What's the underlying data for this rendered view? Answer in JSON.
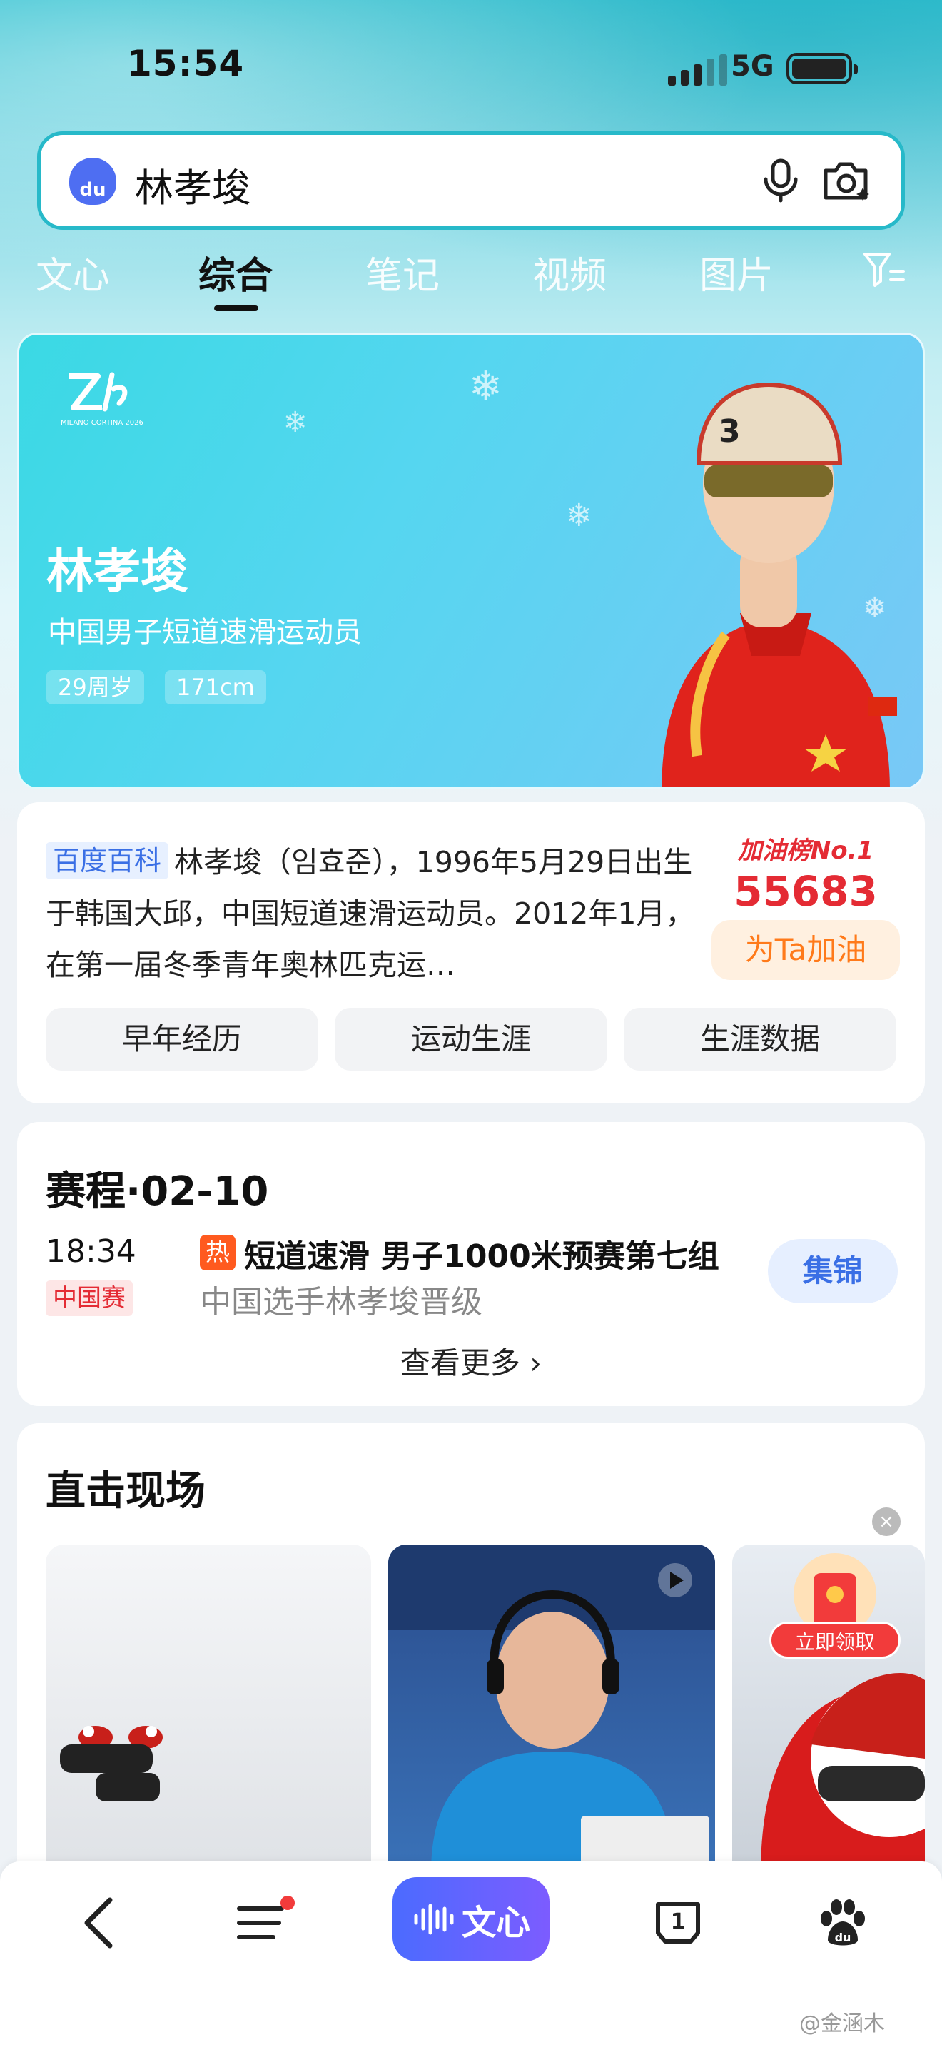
{
  "status_bar": {
    "time": "15:54",
    "network": "5G"
  },
  "search": {
    "query": "林孝埈",
    "logo_text": "du"
  },
  "tabs": [
    "文心",
    "综合",
    "笔记",
    "视频",
    "图片"
  ],
  "active_tab": "综合",
  "hero": {
    "name": "林孝埈",
    "description": "中国男子短道速滑运动员",
    "tags": [
      "29周岁",
      "171cm"
    ],
    "emblem_caption": "MILANO CORTINA 2026"
  },
  "baike": {
    "source_tag": "百度百科",
    "text": "林孝埈（임효준），1996年5月29日出生于韩国大邱，中国短道速滑运动员。2012年1月，在第一届冬季青年奥林匹克运…",
    "cheer_title": "加油榜No.1",
    "cheer_count": "55683",
    "cheer_button": "为Ta加油",
    "pills": [
      "早年经历",
      "运动生涯",
      "生涯数据"
    ]
  },
  "schedule": {
    "title": "赛程·02-10",
    "time": "18:34",
    "badge": "中国赛",
    "hot_label": "热",
    "event": "短道速滑 男子1000米预赛第七组",
    "subtitle": "中国选手林孝埈晋级",
    "highlight_button": "集锦",
    "more_label": "查看更多 ›"
  },
  "live": {
    "title": "直击现场",
    "promo_button": "立即领取"
  },
  "bottom_nav": {
    "wenxin_label": "文心",
    "tab_count": "1"
  },
  "watermark": "@金涵木",
  "colors": {
    "accent_teal": "#27b9c9",
    "baidu_blue": "#4e6ef2",
    "red": "#e42b34",
    "orange": "#ff7a1a"
  }
}
